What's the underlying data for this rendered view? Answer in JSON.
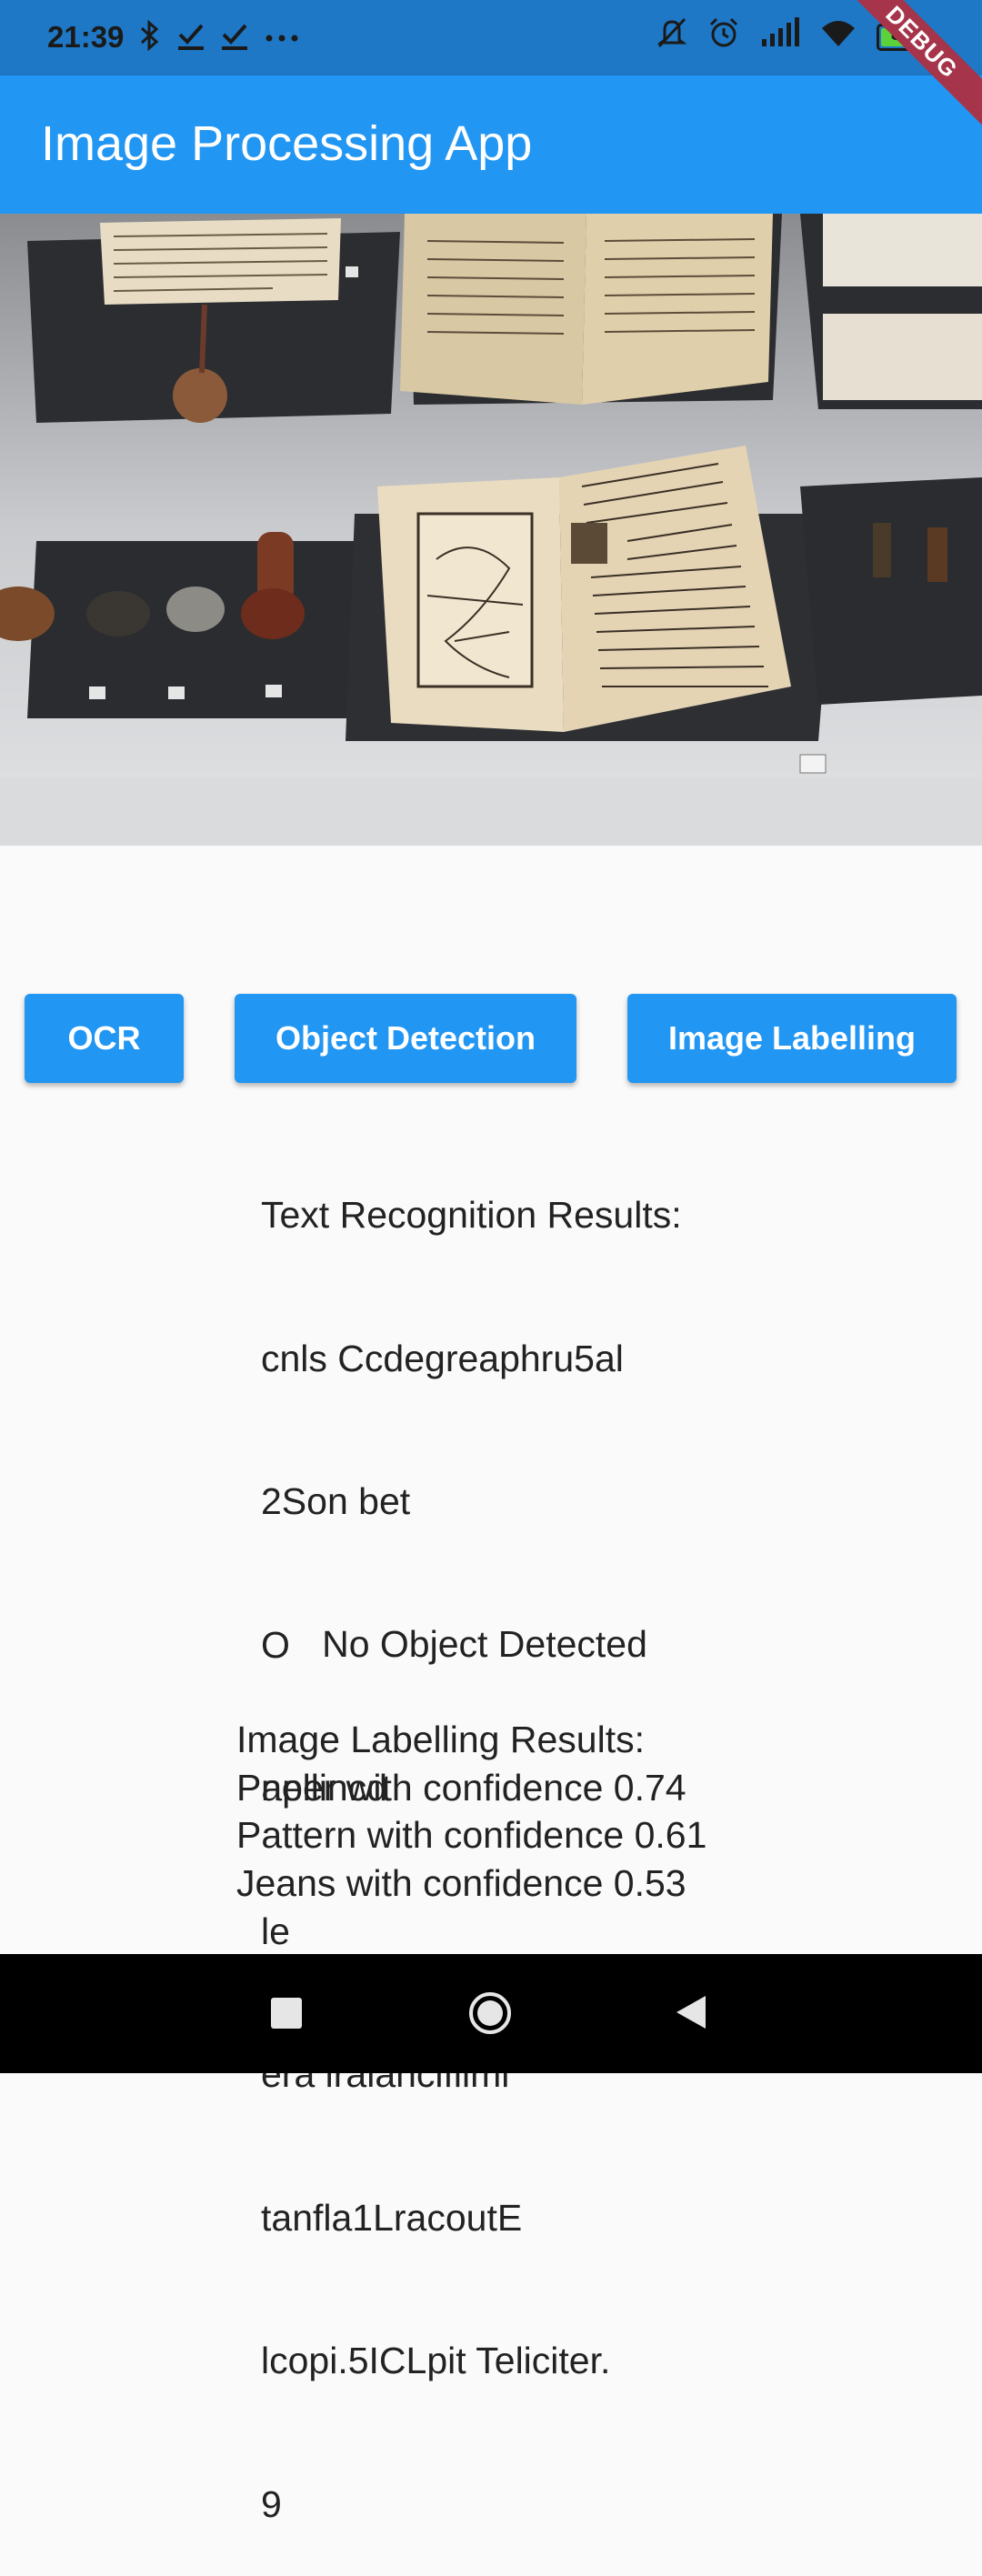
{
  "status_bar": {
    "time": "21:39",
    "left_icons": [
      "bluetooth-icon",
      "check-icon",
      "check-icon",
      "more-icon"
    ],
    "right_icons": [
      "mute-icon",
      "alarm-icon",
      "signal-icon",
      "wifi-icon"
    ],
    "battery_percent": "84",
    "battery_level": 0.84
  },
  "debug_banner": "DEBUG",
  "app_bar": {
    "title": "Image Processing App"
  },
  "buttons": {
    "ocr": "OCR",
    "object_detection": "Object Detection",
    "image_labelling": "Image Labelling"
  },
  "results": {
    "ocr": [
      "Text Recognition Results:",
      "cnls Ccdegreaphru5al",
      "2Son bet",
      "O",
      "nellincd",
      "le",
      "era iralancifiimi",
      "tanfla1LracoutE",
      "lcopi.5ICLpit Teliciter.",
      "9"
    ],
    "object_detection": "No Object Detected",
    "labelling": [
      "Image Labelling Results:",
      "Paper with confidence 0.74",
      "Pattern with confidence 0.61",
      "Jeans with confidence 0.53"
    ]
  },
  "colors": {
    "primary": "#2196f3",
    "status_bar": "#1e78c6",
    "debug_ribbon": "#a6344a",
    "background": "#fafafa"
  }
}
